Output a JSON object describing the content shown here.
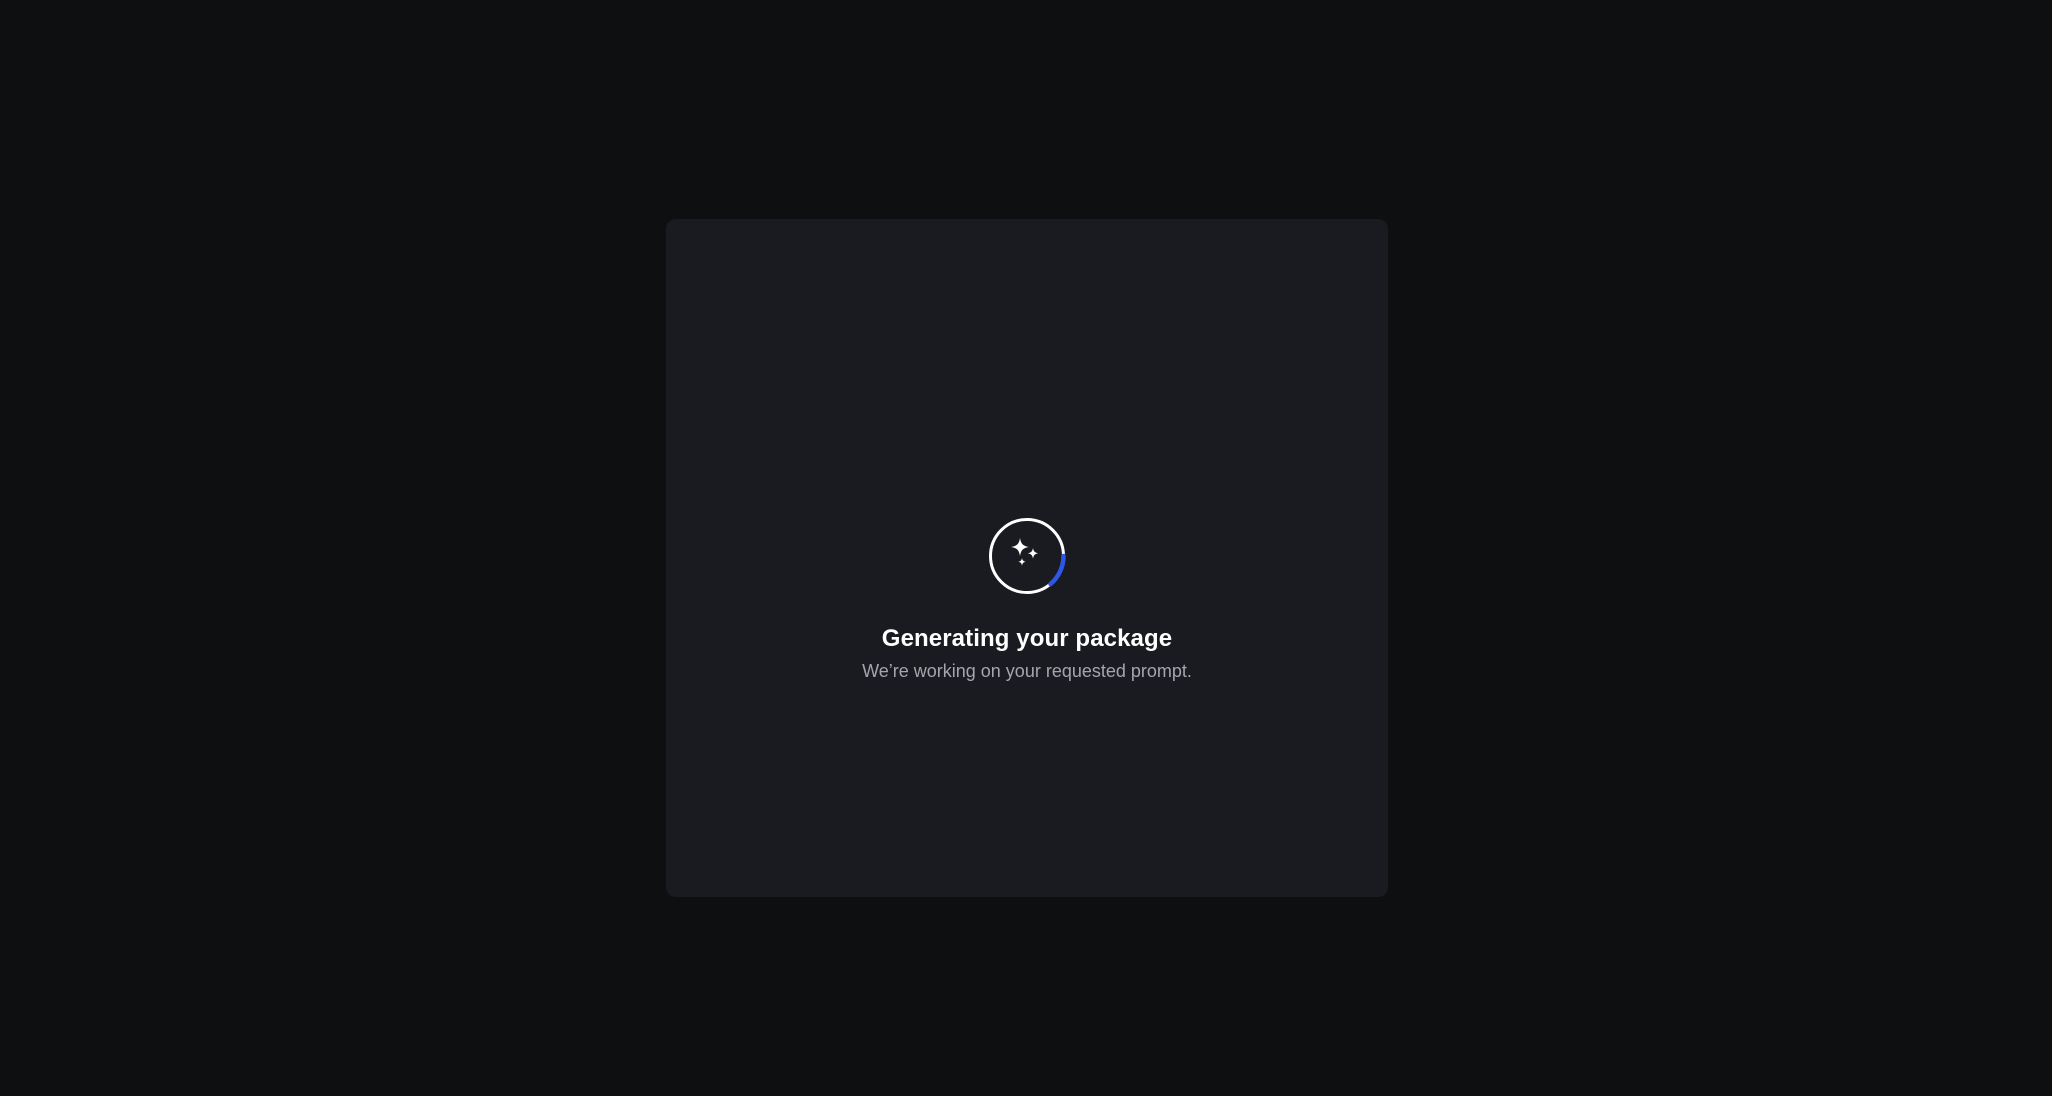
{
  "loading_card": {
    "title": "Generating your package",
    "subtitle": "We’re working on your requested prompt.",
    "icon": "sparkles-icon",
    "spinner_accent_color": "#2f56e6",
    "spinner_ring_color": "#ffffff"
  },
  "colors": {
    "page_background": "#0e0f11",
    "card_background": "#1a1b20",
    "title": "#ffffff",
    "subtitle": "#a3a6ad"
  }
}
